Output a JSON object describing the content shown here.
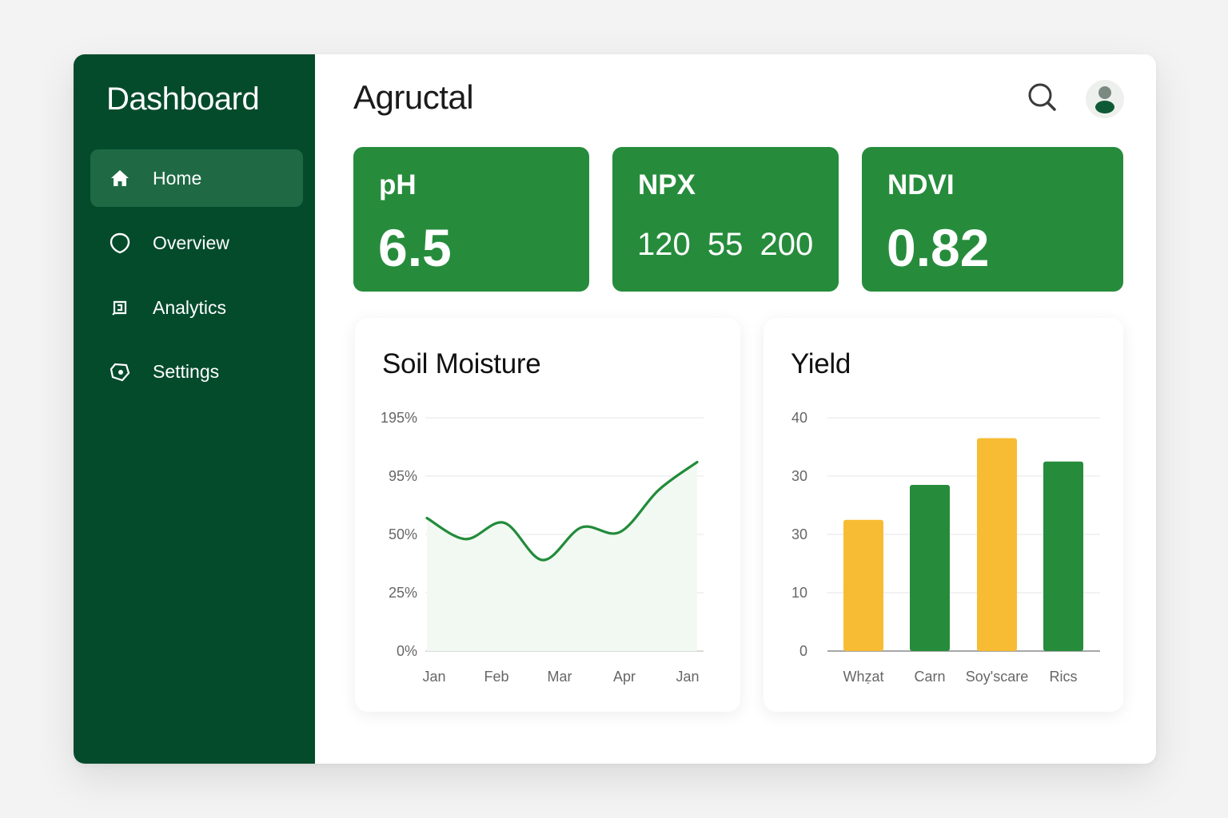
{
  "sidebar": {
    "title": "Dashboard",
    "items": [
      {
        "label": "Home",
        "icon": "home-icon",
        "active": true
      },
      {
        "label": "Overview",
        "icon": "shield-icon",
        "active": false
      },
      {
        "label": "Analytics",
        "icon": "analytics-icon",
        "active": false
      },
      {
        "label": "Settings",
        "icon": "settings-icon",
        "active": false
      }
    ]
  },
  "header": {
    "title": "Agructal",
    "search_icon": "search-icon",
    "avatar_icon": "user-avatar-icon"
  },
  "cards": [
    {
      "label": "pH",
      "value": "6.5"
    },
    {
      "label": "NPX",
      "value": "120 55 200"
    },
    {
      "label": "NDVI",
      "value": "0.82"
    }
  ],
  "colors": {
    "sidebar": "#044b2c",
    "sidebar_active": "#1f6a45",
    "card": "#268c3c",
    "line": "#228b3a",
    "bar_green": "#268c3c",
    "bar_yellow": "#f7bc34"
  },
  "chart_data": [
    {
      "type": "area",
      "title": "Soil Moisture",
      "categories": [
        "Jan",
        "Feb",
        "Mar",
        "Apr",
        "Jan"
      ],
      "y_ticks": [
        "0%",
        "25%",
        "50%",
        "95%",
        "195%"
      ],
      "y_tick_values": [
        0,
        25,
        50,
        75,
        100
      ],
      "series": [
        {
          "values": [
            57,
            48,
            55,
            39,
            53,
            51,
            69,
            81
          ]
        }
      ],
      "grid": true
    },
    {
      "type": "bar",
      "title": "Yield",
      "categories": [
        "Whẓat",
        "Carn",
        "Soy'scare",
        "Rics"
      ],
      "values": [
        22.5,
        28.5,
        36.5,
        32.5
      ],
      "bar_colors": [
        "#f7bc34",
        "#268c3c",
        "#f7bc34",
        "#268c3c"
      ],
      "y_ticks": [
        "0",
        "10",
        "30",
        "30",
        "40"
      ],
      "ylim": [
        0,
        40
      ],
      "grid": true
    }
  ]
}
